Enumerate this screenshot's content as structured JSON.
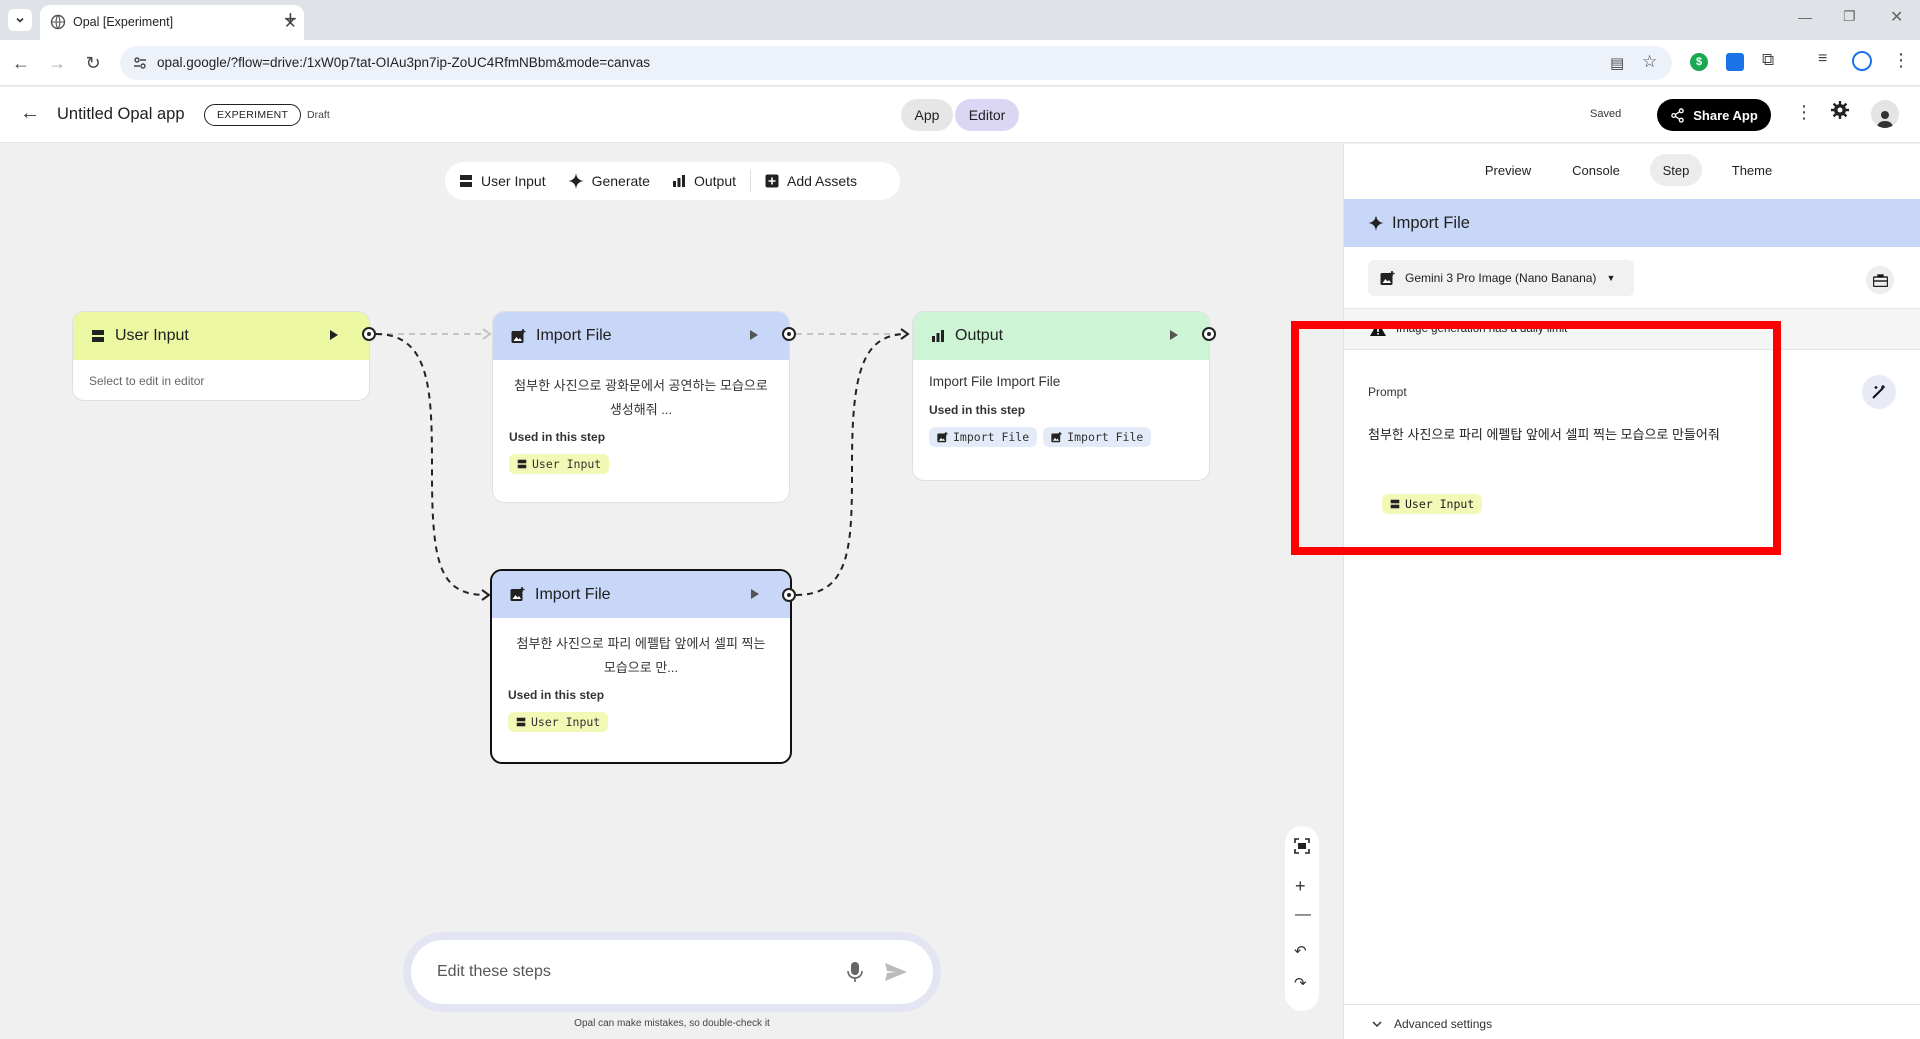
{
  "browser": {
    "tab_title": "Opal [Experiment]",
    "url": "opal.google/?flow=drive:/1xW0p7tat-OIAu3pn7ip-ZoUC4RfmNBbm&mode=canvas"
  },
  "header": {
    "app_title": "Untitled Opal app",
    "badge": "EXPERIMENT",
    "status": "Draft",
    "mode_app": "App",
    "mode_editor": "Editor",
    "saved": "Saved",
    "share": "Share App"
  },
  "addbar": {
    "user_input": "User Input",
    "generate": "Generate",
    "output": "Output",
    "add_assets": "Add Assets"
  },
  "nodes": {
    "user_input": {
      "title": "User Input",
      "hint": "Select to edit in editor",
      "color": "#ecf7a2"
    },
    "import1": {
      "title": "Import File",
      "text": "첨부한 사진으로 광화문에서 공연하는 모습으로 생성해줘 ...",
      "used_label": "Used in this step",
      "chip": "User Input",
      "color": "#c8d7f7"
    },
    "import2": {
      "title": "Import File",
      "text": "첨부한 사진으로 파리 에펠탑 앞에서 셀피 찍는 모습으로 만...",
      "used_label": "Used in this step",
      "chip": "User Input"
    },
    "output": {
      "title": "Output",
      "text": "Import File Import File",
      "used_label": "Used in this step",
      "chip1": "Import File",
      "chip2": "Import File",
      "color": "#cdf5d5"
    }
  },
  "panel": {
    "tabs": [
      "Preview",
      "Console",
      "Step",
      "Theme"
    ],
    "active_tab": "Step",
    "step_title": "Import File",
    "model": "Gemini 3 Pro Image (Nano Banana)",
    "warning": "Image generation has a daily limit",
    "prompt_label": "Prompt",
    "prompt_text": "첨부한 사진으로 파리 에펠탑 앞에서 셀피 찍는 모습으로 만들어줘",
    "prompt_chip": "User Input",
    "advanced": "Advanced settings",
    "highlight_color": "#ff0000"
  },
  "chat": {
    "placeholder": "Edit these steps",
    "disclaimer": "Opal can make mistakes, so double-check it"
  }
}
